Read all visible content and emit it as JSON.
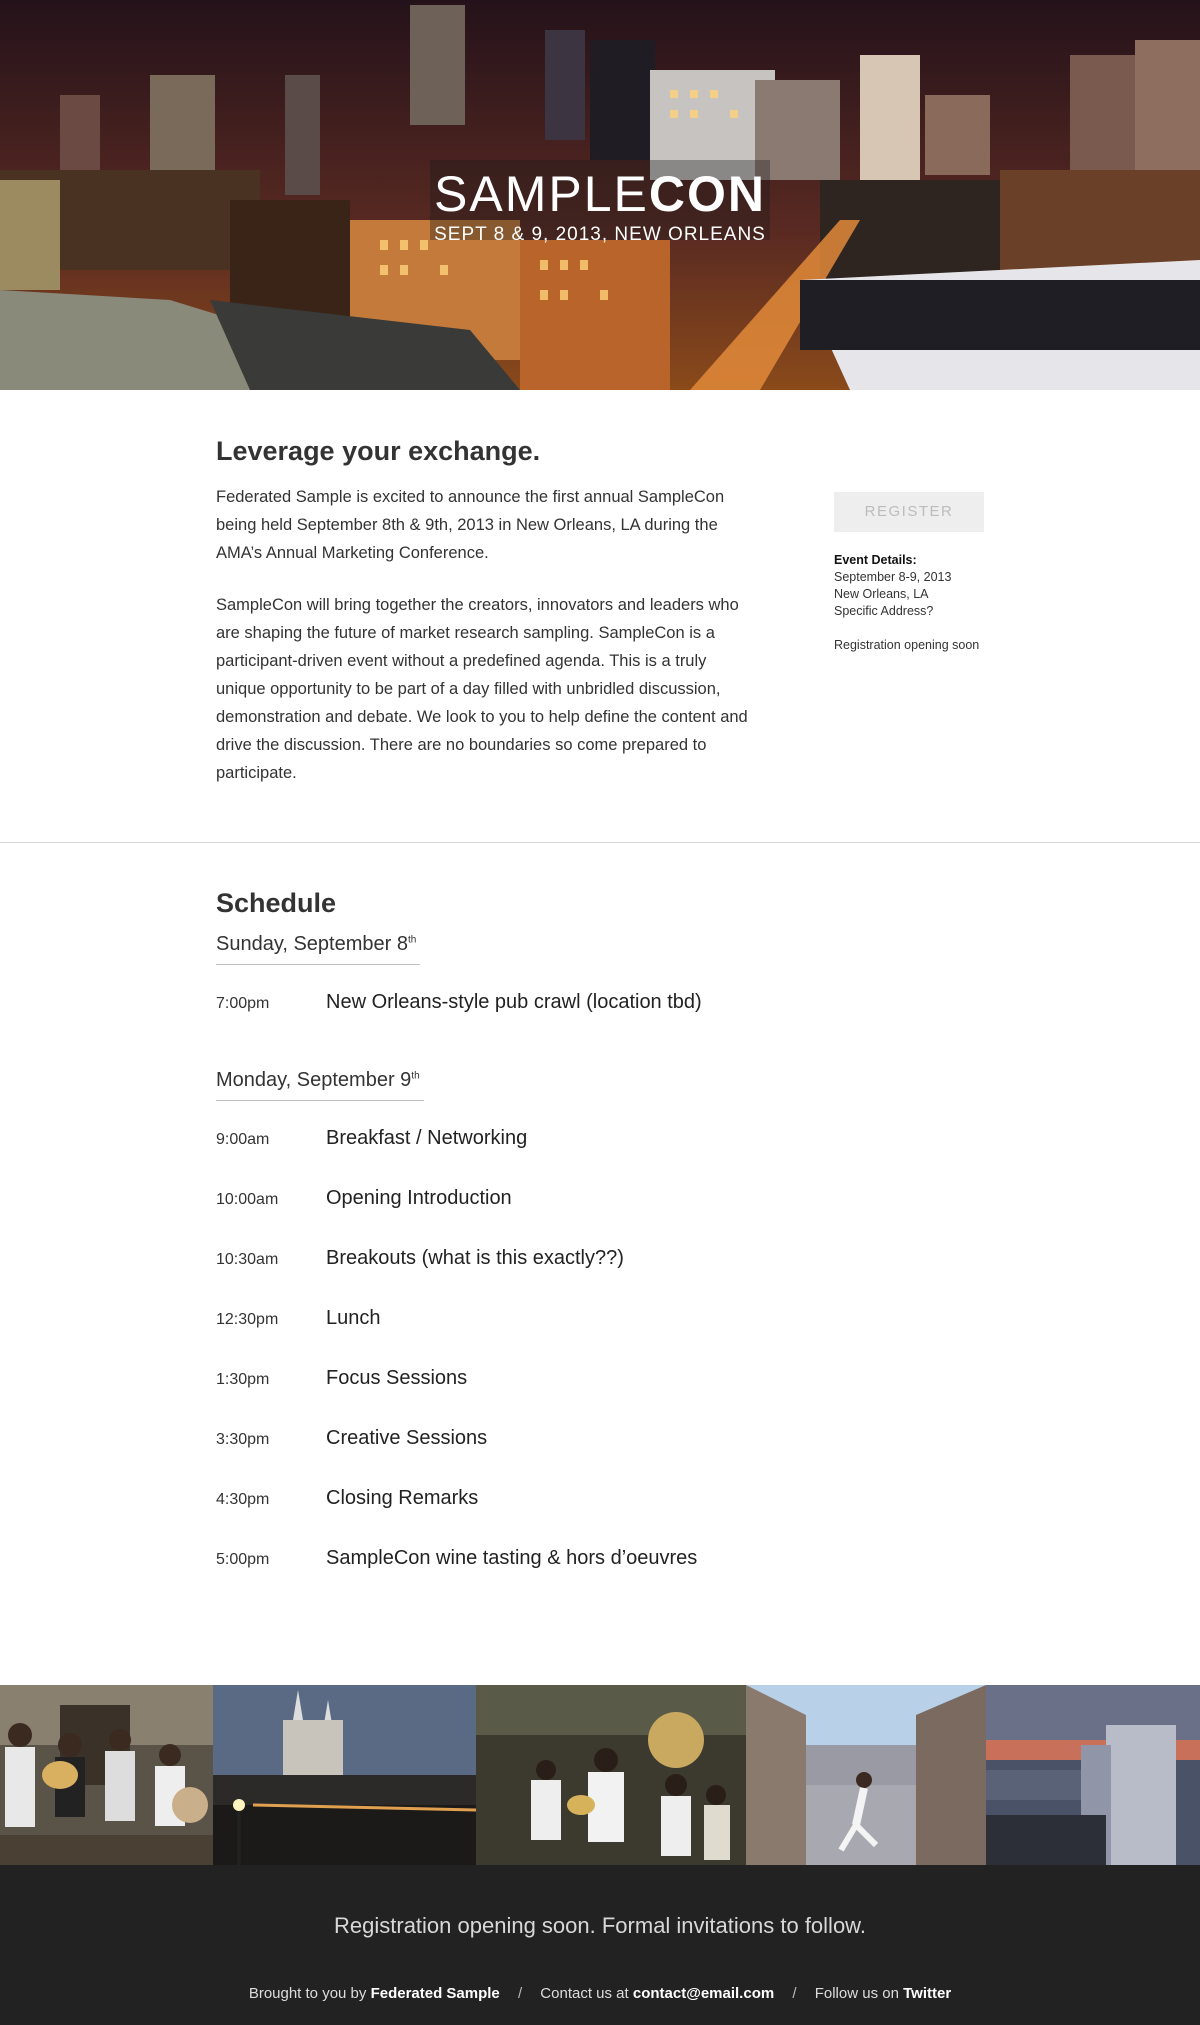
{
  "hero": {
    "title_light": "SAMPLE",
    "title_bold": "CON",
    "subtitle": "SEPT 8 & 9, 2013, NEW ORLEANS"
  },
  "intro": {
    "heading": "Leverage your exchange.",
    "paragraph1": "Federated Sample is excited to announce the first annual SampleCon being held September 8th & 9th, 2013 in New Orleans, LA during the AMA’s Annual Marketing Conference.",
    "paragraph2": "SampleCon will bring together the creators, innovators and leaders who are shaping the future of market research sampling. SampleCon is a participant-driven event without a predefined agenda. This is a truly unique opportunity to be part of a day filled with unbridled discussion, demonstration and debate. We look to you to help define the content and drive the discussion. There are no boundaries so come prepared to participate."
  },
  "aside": {
    "register_label": "REGISTER",
    "details_title": "Event Details:",
    "details_lines": [
      "September 8-9, 2013",
      "New Orleans, LA",
      "Specific Address?"
    ],
    "note": "Registration opening soon"
  },
  "schedule": {
    "heading": "Schedule",
    "days": [
      {
        "label": "Sunday, September 8",
        "suffix": "th",
        "items": [
          {
            "time": "7:00pm",
            "event": "New Orleans-style pub crawl (location tbd)"
          }
        ]
      },
      {
        "label": "Monday, September 9",
        "suffix": "th",
        "items": [
          {
            "time": "9:00am",
            "event": "Breakfast / Networking"
          },
          {
            "time": "10:00am",
            "event": "Opening Introduction"
          },
          {
            "time": "10:30am",
            "event": "Breakouts (what is this exactly??)"
          },
          {
            "time": "12:30pm",
            "event": "Lunch"
          },
          {
            "time": "1:30pm",
            "event": "Focus Sessions"
          },
          {
            "time": "3:30pm",
            "event": "Creative Sessions"
          },
          {
            "time": "4:30pm",
            "event": "Closing Remarks"
          },
          {
            "time": "5:00pm",
            "event": "SampleCon wine tasting & hors d’oeuvres"
          }
        ]
      }
    ]
  },
  "footer": {
    "tagline": "Registration opening soon. Formal invitations to follow.",
    "brought_prefix": "Brought to you by",
    "brought_name": "Federated Sample",
    "contact_prefix": "Contact us at",
    "contact_email": "contact@email.com",
    "follow_prefix": "Follow us on",
    "follow_name": "Twitter",
    "separator": "/"
  }
}
